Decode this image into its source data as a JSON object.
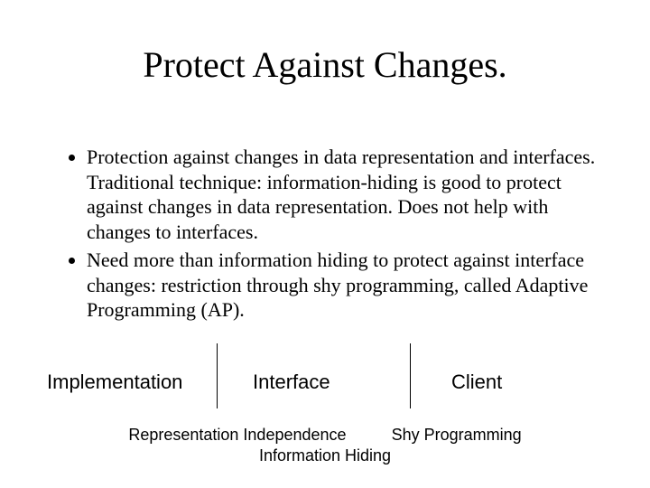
{
  "title": "Protect Against Changes.",
  "bullets": {
    "b1": "Protection against changes in data representation and interfaces. Traditional technique: information-hiding is good to protect against changes in data representation. Does not help with changes to interfaces.",
    "b2": "Need more than information hiding to protect against interface changes: restriction through shy programming, called Adaptive Programming (AP)."
  },
  "diagram": {
    "implementation": "Implementation",
    "interface": "Interface",
    "client": "Client",
    "rep_independence": "Representation Independence",
    "shy_programming": "Shy Programming",
    "information_hiding": "Information Hiding"
  }
}
